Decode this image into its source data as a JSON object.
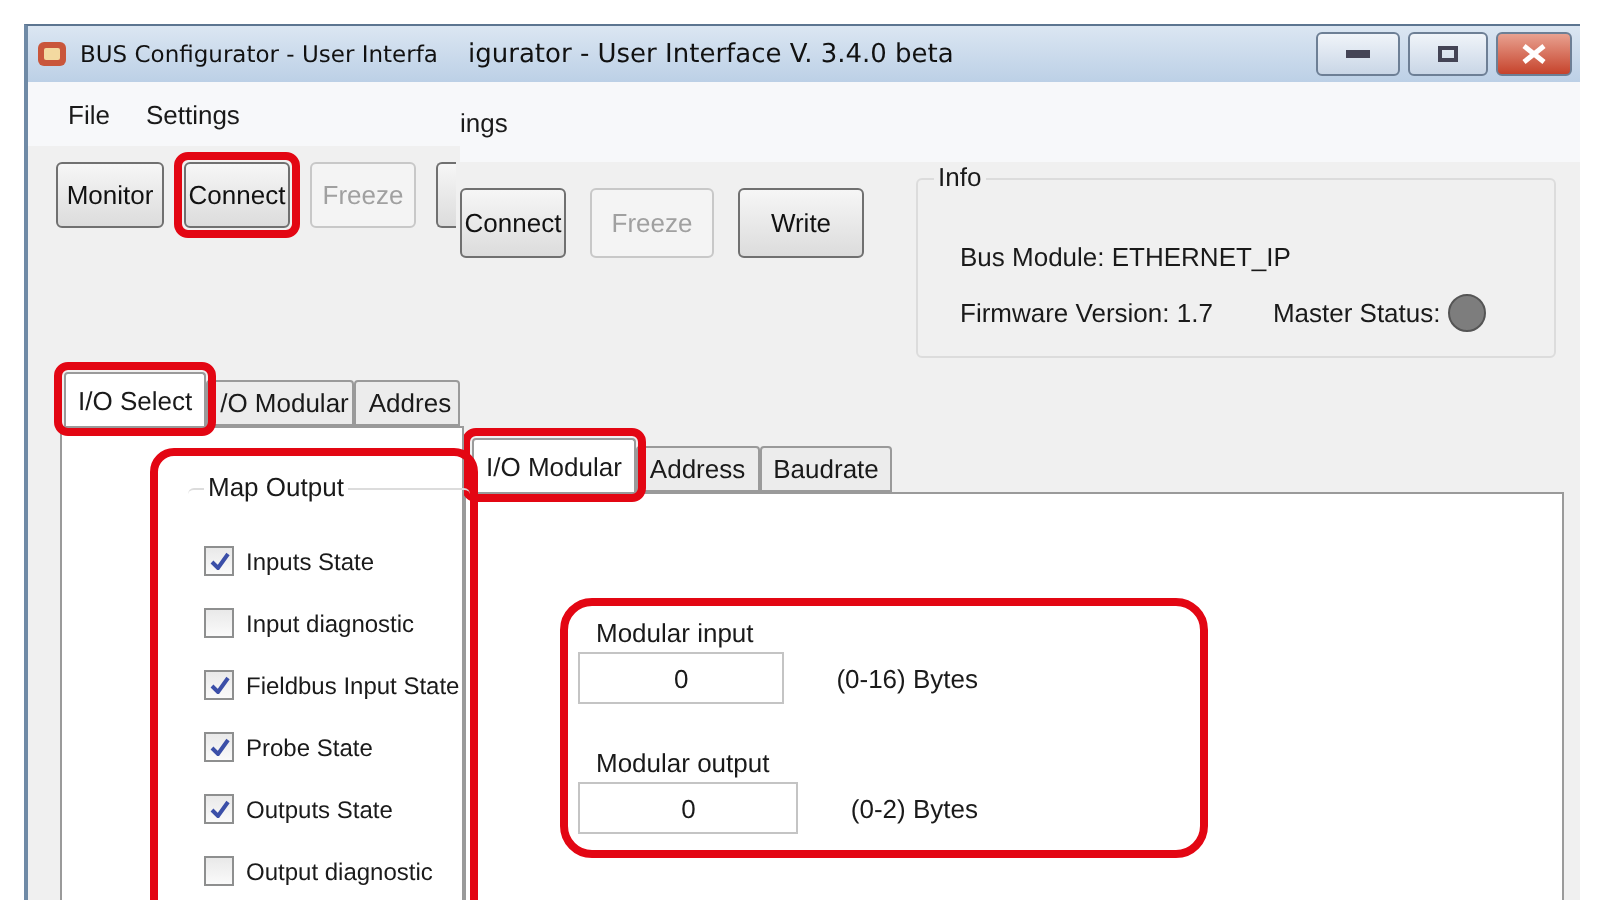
{
  "back_window": {
    "title": "igurator - User Interface  V. 3.4.0 beta",
    "menu": [
      "ings"
    ],
    "buttons": [
      {
        "label": "Connect",
        "disabled": false,
        "highlighted": false
      },
      {
        "label": "Freeze",
        "disabled": true,
        "highlighted": false
      },
      {
        "label": "Write",
        "disabled": false,
        "highlighted": false
      }
    ],
    "info": {
      "title": "Info",
      "bus_module": "Bus Module: ETHERNET_IP",
      "firmware": "Firmware Version: 1.7",
      "master_status": {
        "label": "Master Status:",
        "active": false
      }
    },
    "tabs": [
      {
        "label": "I/O Modular",
        "selected": true,
        "highlighted": true
      },
      {
        "label": "Address",
        "selected": false,
        "highlighted": false
      },
      {
        "label": "Baudrate",
        "selected": false,
        "highlighted": false
      }
    ],
    "modular": {
      "highlighted": true,
      "fields": [
        {
          "label": "Modular input",
          "value": "0",
          "range": "(0-16) Bytes"
        },
        {
          "label": "Modular output",
          "value": "0",
          "range": "(0-2) Bytes"
        }
      ]
    }
  },
  "front_window": {
    "title": "BUS Configurator - User Interfa",
    "menu": [
      "File",
      "Settings"
    ],
    "buttons": [
      {
        "label": "Monitor",
        "disabled": false,
        "highlighted": false
      },
      {
        "label": "Connect",
        "disabled": false,
        "highlighted": true
      },
      {
        "label": "Freeze",
        "disabled": true,
        "highlighted": false
      }
    ],
    "tabs": [
      {
        "label": "I/O Select",
        "selected": true,
        "highlighted": true
      },
      {
        "label": "/O Modular",
        "selected": false,
        "highlighted": false
      },
      {
        "label": "Addres",
        "selected": false,
        "highlighted": false
      }
    ],
    "map_output": {
      "title": "Map Output",
      "highlighted": true,
      "items": [
        {
          "label": "Inputs State",
          "checked": true
        },
        {
          "label": "Input diagnostic",
          "checked": false
        },
        {
          "label": "Fieldbus Input State",
          "checked": true
        },
        {
          "label": "Probe State",
          "checked": true
        },
        {
          "label": "Outputs State",
          "checked": true
        },
        {
          "label": "Output diagnostic",
          "checked": false
        }
      ]
    }
  }
}
